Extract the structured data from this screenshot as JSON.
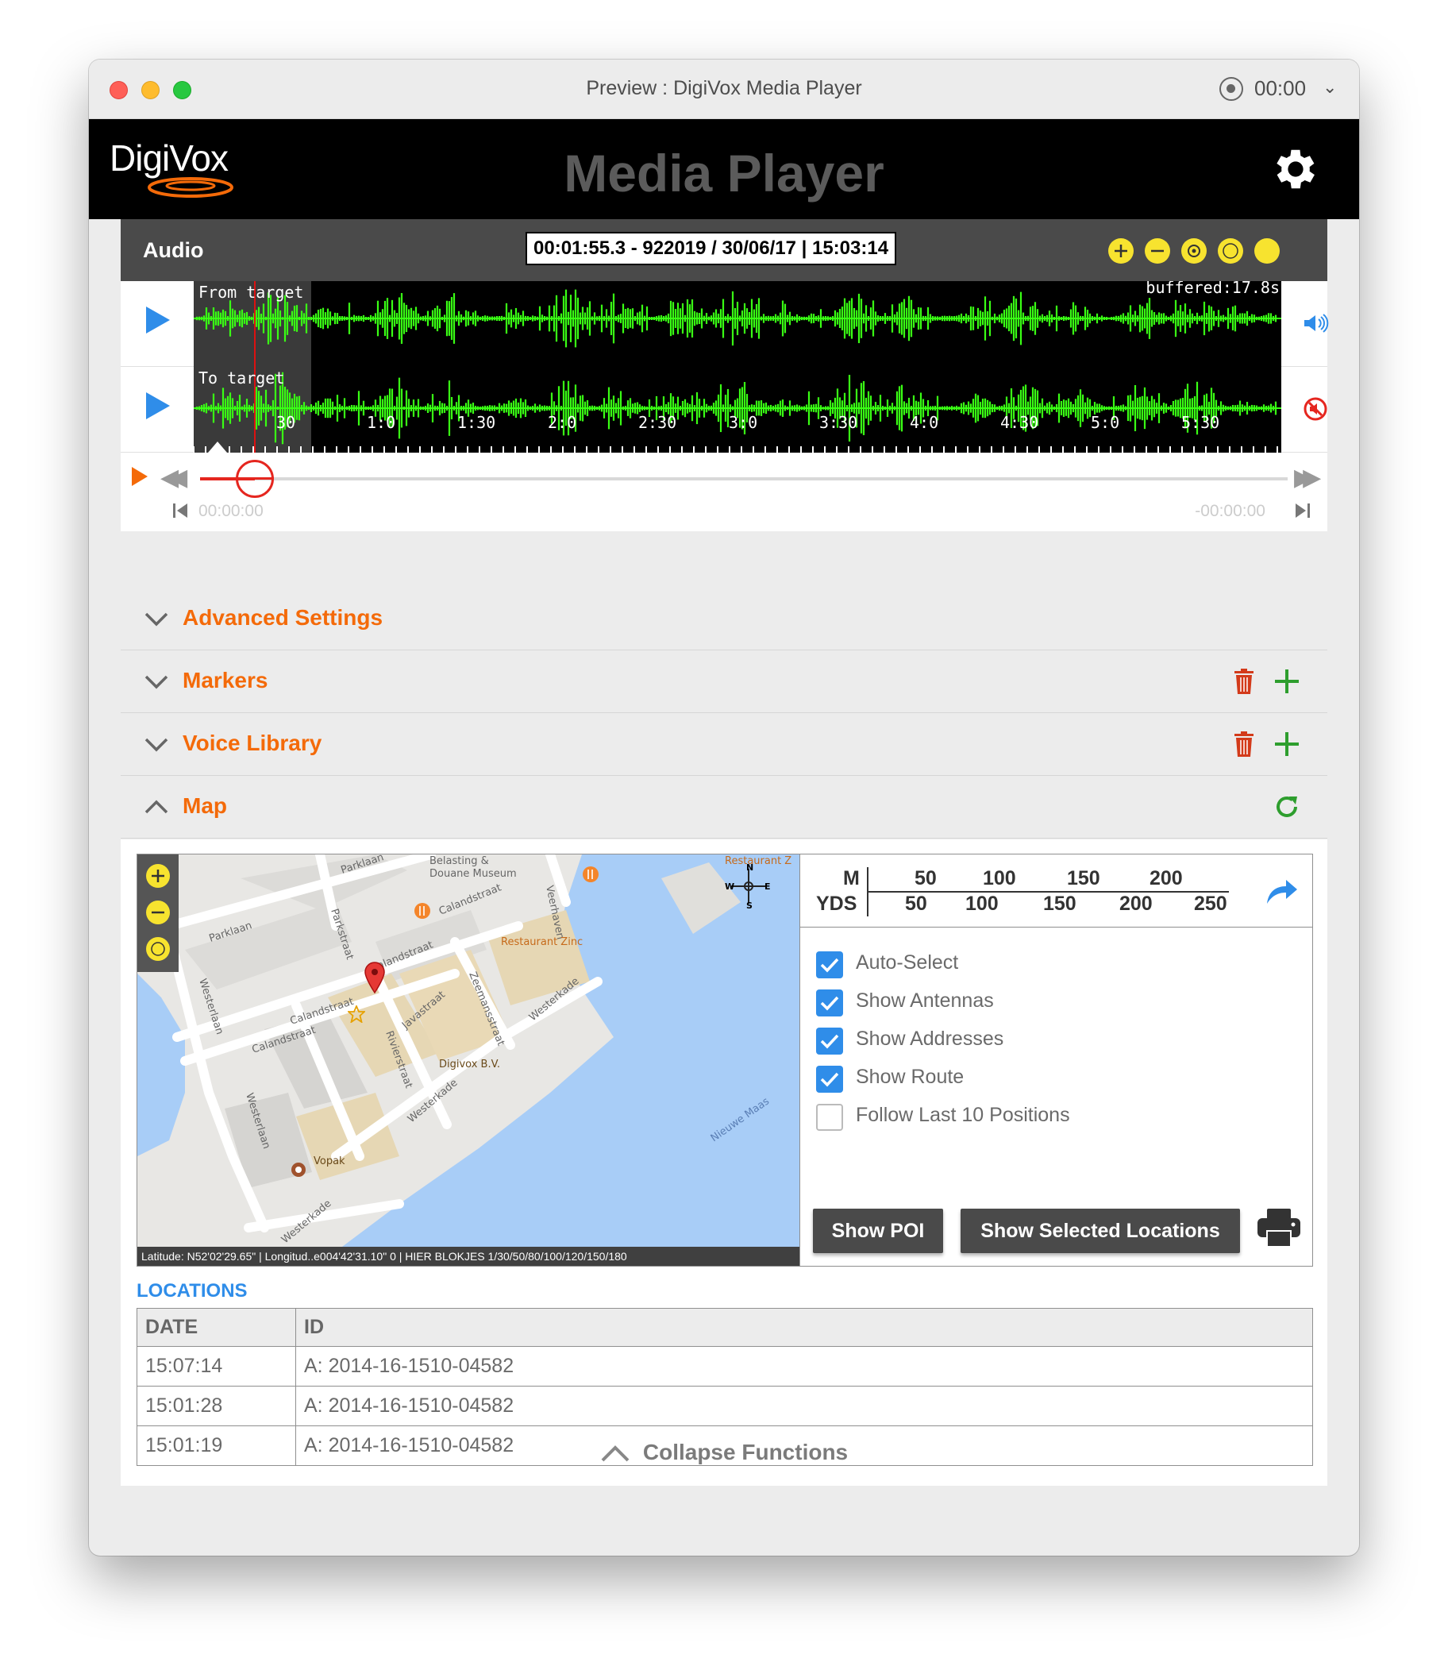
{
  "window": {
    "title": "Preview : DigiVox Media Player",
    "record_time": "00:00"
  },
  "header": {
    "logo": "DigiVox",
    "title": "Media Player"
  },
  "audio": {
    "title": "Audio",
    "timestamp": "00:01:55.3 - 922019 / 30/06/17 | 15:03:14",
    "tracks": [
      {
        "label": "From target",
        "extra": "buffered:17.8s"
      },
      {
        "label": "To target"
      }
    ],
    "ticks": [
      "30",
      "1:0",
      "1:30",
      "2:0",
      "2:30",
      "3:0",
      "3:30",
      "4:0",
      "4:30",
      "5:0",
      "5:30"
    ],
    "time_start": "00:00:00",
    "time_end": "-00:00:00",
    "progress_fraction": 0.05
  },
  "sections": [
    {
      "title": "Advanced Settings"
    },
    {
      "title": "Markers"
    },
    {
      "title": "Voice Library"
    },
    {
      "title": "Map"
    }
  ],
  "map": {
    "streets": [
      "Parklaan",
      "Parklaan",
      "Parkstraat",
      "Calandstraat",
      "Calandstraat",
      "Calandstraat",
      "Calandstraat",
      "Zeemansstraat",
      "Westerkade",
      "Javastraat",
      "Rivierstraat",
      "Westerkade",
      "Westerlaan",
      "Westerlaan",
      "Westerkade",
      "Veerhaven",
      "Nieuwe Maas"
    ],
    "places": [
      "Belasting & Douane Museum",
      "Restaurant Zinc",
      "Digivox B.V.",
      "Vopak",
      "Restaurant Z"
    ],
    "footer": "Latitude: N52'02'29.65\"  |  Longitud..e004'42'31.10\"  0  |  HIER BLOKJES 1/30/50/80/100/120/150/180",
    "scale": {
      "m_label": "M",
      "yds_label": "YDS",
      "m_values": [
        "50",
        "100",
        "150",
        "200"
      ],
      "yds_values": [
        "50",
        "100",
        "150",
        "200",
        "250"
      ]
    },
    "options": [
      {
        "label": "Auto-Select",
        "checked": true
      },
      {
        "label": "Show Antennas",
        "checked": true
      },
      {
        "label": "Show Addresses",
        "checked": true
      },
      {
        "label": "Show Route",
        "checked": true
      },
      {
        "label": "Follow Last 10 Positions",
        "checked": false
      }
    ],
    "buttons": {
      "poi": "Show POI",
      "selected": "Show Selected Locations"
    }
  },
  "locations": {
    "title": "LOCATIONS",
    "columns": [
      "DATE",
      "ID"
    ],
    "rows": [
      {
        "date": "15:07:14",
        "id": "A: 2014-16-1510-04582"
      },
      {
        "date": "15:01:28",
        "id": "A: 2014-16-1510-04582"
      },
      {
        "date": "15:01:19",
        "id": "A: 2014-16-1510-04582"
      }
    ]
  },
  "footer": {
    "collapse": "Collapse Functions"
  },
  "colors": {
    "accent": "#f46a09",
    "play_blue": "#2f8de9",
    "wave_green": "#39ff14",
    "yellow_btn": "#f7e32f",
    "header_bg": "#000000"
  }
}
